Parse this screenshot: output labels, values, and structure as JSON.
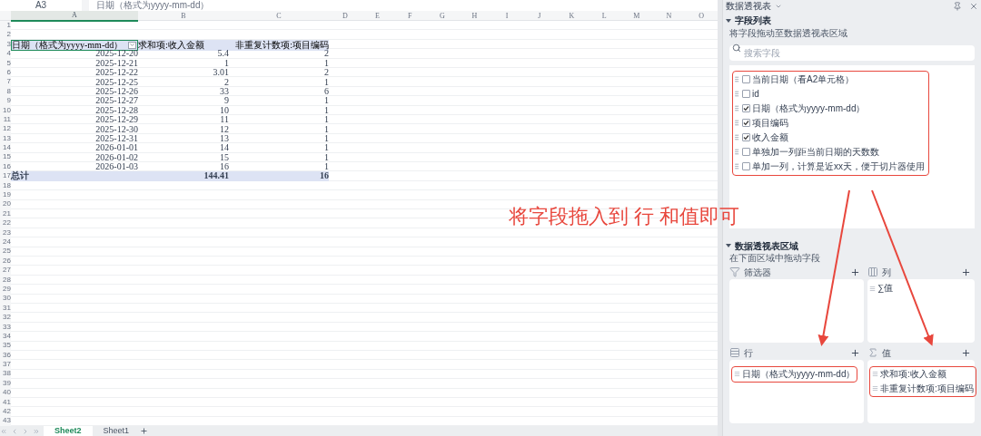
{
  "formula_bar": {
    "cell": "A3",
    "formula": "日期（格式为yyyy-mm-dd）"
  },
  "columns": [
    {
      "label": "A",
      "selected": true
    },
    {
      "label": "B",
      "selected": false
    },
    {
      "label": "C",
      "selected": false
    },
    {
      "label": "D",
      "selected": false
    },
    {
      "label": "E",
      "selected": false
    },
    {
      "label": "F",
      "selected": false
    },
    {
      "label": "G",
      "selected": false
    },
    {
      "label": "H",
      "selected": false
    },
    {
      "label": "I",
      "selected": false
    },
    {
      "label": "J",
      "selected": false
    },
    {
      "label": "K",
      "selected": false
    },
    {
      "label": "L",
      "selected": false
    },
    {
      "label": "M",
      "selected": false
    },
    {
      "label": "N",
      "selected": false
    },
    {
      "label": "O",
      "selected": false
    }
  ],
  "row_numbers": [
    "1",
    "2",
    "3",
    "4",
    "5",
    "6",
    "7",
    "8",
    "9",
    "10",
    "11",
    "12",
    "13",
    "14",
    "15",
    "16",
    "17",
    "18",
    "19",
    "20",
    "21",
    "22",
    "23",
    "24",
    "25",
    "26",
    "27",
    "28",
    "29",
    "30",
    "31",
    "32",
    "33",
    "34",
    "35",
    "36",
    "37",
    "38",
    "39",
    "40",
    "41",
    "42",
    "43"
  ],
  "pivot": {
    "headers": [
      "日期（格式为yyyy-mm-dd）",
      "求和项:收入金额",
      "非重复计数项:项目编码"
    ],
    "rows": [
      [
        "2025-12-20",
        "5.4",
        "2"
      ],
      [
        "2025-12-21",
        "1",
        "1"
      ],
      [
        "2025-12-22",
        "3.01",
        "2"
      ],
      [
        "2025-12-25",
        "2",
        "1"
      ],
      [
        "2025-12-26",
        "33",
        "6"
      ],
      [
        "2025-12-27",
        "9",
        "1"
      ],
      [
        "2025-12-28",
        "10",
        "1"
      ],
      [
        "2025-12-29",
        "11",
        "1"
      ],
      [
        "2025-12-30",
        "12",
        "1"
      ],
      [
        "2025-12-31",
        "13",
        "1"
      ],
      [
        "2026-01-01",
        "14",
        "1"
      ],
      [
        "2026-01-02",
        "15",
        "1"
      ],
      [
        "2026-01-03",
        "16",
        "1"
      ]
    ],
    "total": [
      "总计",
      "144.41",
      "16"
    ]
  },
  "sheet_tabs": [
    {
      "label": "Sheet2",
      "selected": true
    },
    {
      "label": "Sheet1",
      "selected": false
    }
  ],
  "panel": {
    "title": "数据透视表",
    "field_list": {
      "title": "字段列表",
      "expanded": true,
      "hint": "将字段拖动至数据透视表区域",
      "search_placeholder": "搜索字段",
      "fields": [
        {
          "label": "当前日期（看A2单元格）",
          "checked": false
        },
        {
          "label": "id",
          "checked": false
        },
        {
          "label": "日期（格式为yyyy-mm-dd）",
          "checked": true
        },
        {
          "label": "项目编码",
          "checked": true
        },
        {
          "label": "收入金额",
          "checked": true
        },
        {
          "label": "单独加一列距当前日期的天数数",
          "checked": false
        },
        {
          "label": "单加一列，计算是近xx天，便于切片器使用",
          "checked": false
        }
      ]
    },
    "areas_section": {
      "title": "数据透视表区域",
      "expanded": true,
      "hint": "在下面区域中拖动字段",
      "areas": [
        {
          "kind": "filter",
          "label": "筛选器"
        },
        {
          "kind": "columns",
          "label": "列",
          "items": [
            "∑值"
          ],
          "highlighted": false
        },
        {
          "kind": "rows",
          "label": "行",
          "items": [
            "日期（格式为yyyy-mm-dd）"
          ],
          "highlighted": true
        },
        {
          "kind": "values",
          "label": "值",
          "items": [
            "求和项:收入金额",
            "非重复计数项:项目编码"
          ],
          "highlighted": true
        }
      ]
    }
  },
  "annotation": {
    "text": "将字段拖入到 行 和值即可"
  }
}
